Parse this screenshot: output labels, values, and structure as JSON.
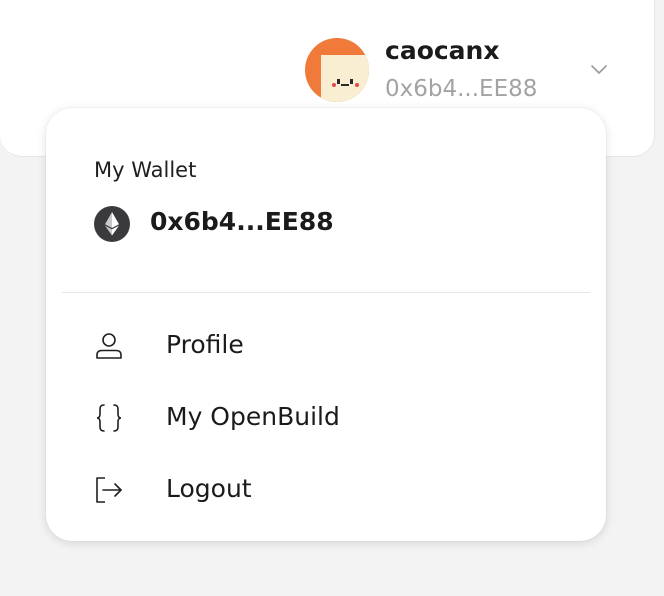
{
  "header": {
    "username": "caocanx",
    "address_short": "0x6b4...EE88"
  },
  "dropdown": {
    "wallet_title": "My Wallet",
    "wallet_address": "0x6b4...EE88",
    "items": [
      {
        "label": "Profile",
        "icon": "user-icon"
      },
      {
        "label": "My OpenBuild",
        "icon": "braces-icon"
      },
      {
        "label": "Logout",
        "icon": "logout-icon"
      }
    ]
  },
  "colors": {
    "avatar_bg": "#ef7a3a",
    "avatar_face": "#faeed2",
    "muted_text": "#a3a3a3",
    "page_bg": "#f3f3f3"
  }
}
